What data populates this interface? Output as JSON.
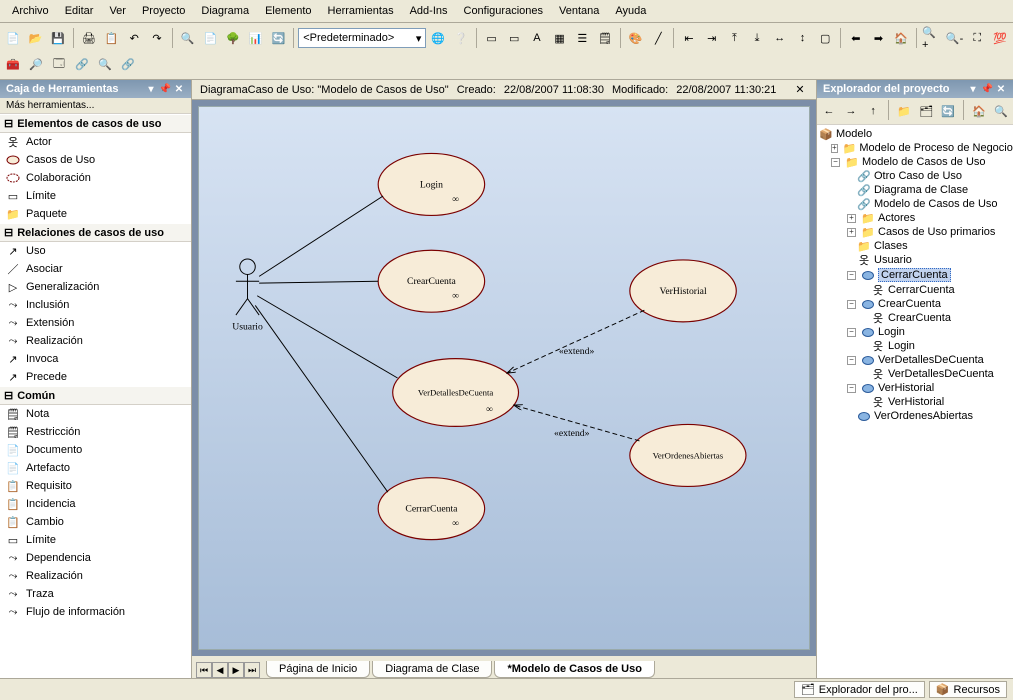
{
  "menu": [
    "Archivo",
    "Editar",
    "Ver",
    "Proyecto",
    "Diagrama",
    "Elemento",
    "Herramientas",
    "Add-Ins",
    "Configuraciones",
    "Ventana",
    "Ayuda"
  ],
  "combo_style": "<Predeterminado>",
  "toolbox": {
    "title": "Caja de Herramientas",
    "more": "Más herramientas...",
    "section1": {
      "title": "Elementos de casos de uso",
      "items": [
        "Actor",
        "Casos de Uso",
        "Colaboración",
        "Límite",
        "Paquete"
      ]
    },
    "section2": {
      "title": "Relaciones de casos de uso",
      "items": [
        "Uso",
        "Asociar",
        "Generalización",
        "Inclusión",
        "Extensión",
        "Realización",
        "Invoca",
        "Precede"
      ]
    },
    "section3": {
      "title": "Común",
      "items": [
        "Nota",
        "Restricción",
        "Documento",
        "Artefacto",
        "Requisito",
        "Incidencia",
        "Cambio",
        "Límite",
        "Dependencia",
        "Realización",
        "Traza",
        "Flujo de información"
      ]
    }
  },
  "diagram": {
    "header_prefix": "DiagramaCaso de Uso: \"Modelo de Casos de Uso\"",
    "created_label": "Creado:",
    "created": "22/08/2007 11:08:30",
    "modified_label": "Modificado:",
    "modified": "22/08/2007 11:30:21",
    "actor": "Usuario",
    "usecases": {
      "login": "Login",
      "crearcuenta": "CrearCuenta",
      "verhistorial": "VerHistorial",
      "verdetalles": "VerDetallesDeCuenta",
      "verordenes": "VerOrdenesAbiertas",
      "cerrarcuenta": "CerrarCuenta"
    },
    "extend_label": "«extend»"
  },
  "tabs": {
    "t1": "Página de Inicio",
    "t2": "Diagrama de Clase",
    "t3": "*Modelo de Casos de Uso"
  },
  "explorer": {
    "title": "Explorador del proyecto",
    "root": "Modelo",
    "mpn": "Modelo de Proceso de Negocios",
    "mcu": "Modelo de Casos de Uso",
    "otro": "Otro Caso de Uso",
    "diagclase": "Diagrama de Clase",
    "mcu2": "Modelo de Casos de Uso",
    "actores": "Actores",
    "casosprim": "Casos de Uso primarios",
    "clases": "Clases",
    "usuario": "Usuario",
    "cerrar": "CerrarCuenta",
    "crear": "CrearCuenta",
    "login": "Login",
    "verdet": "VerDetallesDeCuenta",
    "verhist": "VerHistorial",
    "verord": "VerOrdenesAbiertas"
  },
  "status": {
    "tab1": "Explorador del pro...",
    "tab2": "Recursos"
  },
  "chart_data": {
    "type": "uml_use_case_diagram",
    "actor": "Usuario",
    "use_cases": [
      "Login",
      "CrearCuenta",
      "VerDetallesDeCuenta",
      "CerrarCuenta",
      "VerHistorial",
      "VerOrdenesAbiertas"
    ],
    "associations": [
      {
        "from": "Usuario",
        "to": "Login",
        "type": "association"
      },
      {
        "from": "Usuario",
        "to": "CrearCuenta",
        "type": "association"
      },
      {
        "from": "Usuario",
        "to": "VerDetallesDeCuenta",
        "type": "association"
      },
      {
        "from": "Usuario",
        "to": "CerrarCuenta",
        "type": "association"
      },
      {
        "from": "VerHistorial",
        "to": "VerDetallesDeCuenta",
        "type": "extend"
      },
      {
        "from": "VerOrdenesAbiertas",
        "to": "VerDetallesDeCuenta",
        "type": "extend"
      }
    ]
  }
}
